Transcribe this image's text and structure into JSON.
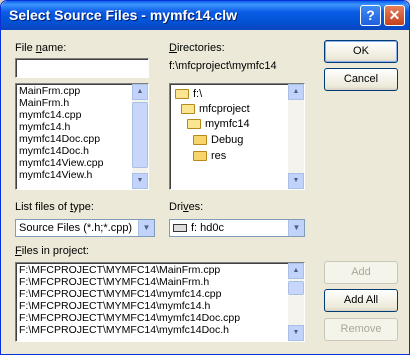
{
  "window": {
    "title": "Select Source Files - mymfc14.clw",
    "help_label": "?",
    "close_label": "✕"
  },
  "file_name": {
    "label_pre": "File ",
    "label_ul": "n",
    "label_post": "ame:",
    "value": ""
  },
  "files": [
    "MainFrm.cpp",
    "MainFrm.h",
    "mymfc14.cpp",
    "mymfc14.h",
    "mymfc14Doc.cpp",
    "mymfc14Doc.h",
    "mymfc14View.cpp",
    "mymfc14View.h"
  ],
  "directories": {
    "label_ul": "D",
    "label_post": "irectories:",
    "current_path": "f:\\mfcproject\\mymfc14",
    "tree": [
      "f:\\",
      "mfcproject",
      "mymfc14",
      "Debug",
      "res"
    ]
  },
  "file_types": {
    "label_pre": "List files of ",
    "label_ul": "t",
    "label_post": "ype:",
    "value": "Source Files (*.h;*.cpp)"
  },
  "drives": {
    "label_pre": "Dri",
    "label_ul": "v",
    "label_post": "es:",
    "value": "f: hd0c"
  },
  "project": {
    "label_ul": "F",
    "label_post": "iles in project:",
    "items": [
      "F:\\MFCPROJECT\\MYMFC14\\MainFrm.cpp",
      "F:\\MFCPROJECT\\MYMFC14\\MainFrm.h",
      "F:\\MFCPROJECT\\MYMFC14\\mymfc14.cpp",
      "F:\\MFCPROJECT\\MYMFC14\\mymfc14.h",
      "F:\\MFCPROJECT\\MYMFC14\\mymfc14Doc.cpp",
      "F:\\MFCPROJECT\\MYMFC14\\mymfc14Doc.h"
    ]
  },
  "buttons": {
    "ok": "OK",
    "cancel": "Cancel",
    "add": "Add",
    "add_all": "Add All",
    "remove": "Remove"
  }
}
